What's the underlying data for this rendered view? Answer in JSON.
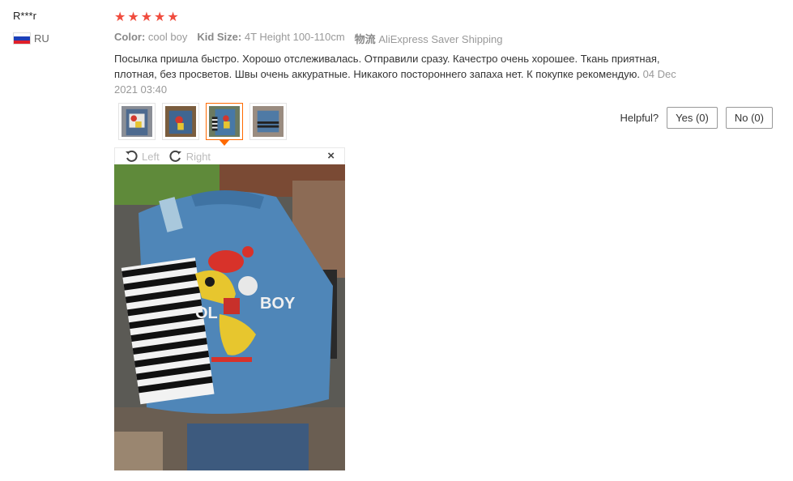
{
  "reviewer": {
    "name": "R***r",
    "country_code": "RU",
    "flag_colors": [
      "#ffffff",
      "#1c3fb8",
      "#e0202a"
    ]
  },
  "rating": {
    "stars": 5,
    "max": 5,
    "color": "#f04c3e"
  },
  "attributes": [
    {
      "label": "Color:",
      "value": "cool boy"
    },
    {
      "label": "Kid Size:",
      "value": "4T Height 100-110cm"
    },
    {
      "label": "物流",
      "value": "AliExpress Saver Shipping"
    }
  ],
  "review": {
    "text": "Посылка пришла быстро. Хорошо отслеживалась. Отправили сразу. Качестро очень хорошее. Ткань приятная, плотная, без просветов. Швы очень аккуратные. Никакого постороннего запаха нет. К покупке рекомендую.",
    "date": "04 Dec 2021 03:40"
  },
  "thumbnails": {
    "count": 4,
    "active_index": 2,
    "accent_color": "#ff6a00"
  },
  "viewer": {
    "rotate_left": "Left",
    "rotate_right": "Right",
    "close": "×"
  },
  "helpful": {
    "label": "Helpful?",
    "yes": "Yes (0)",
    "no": "No (0)"
  }
}
